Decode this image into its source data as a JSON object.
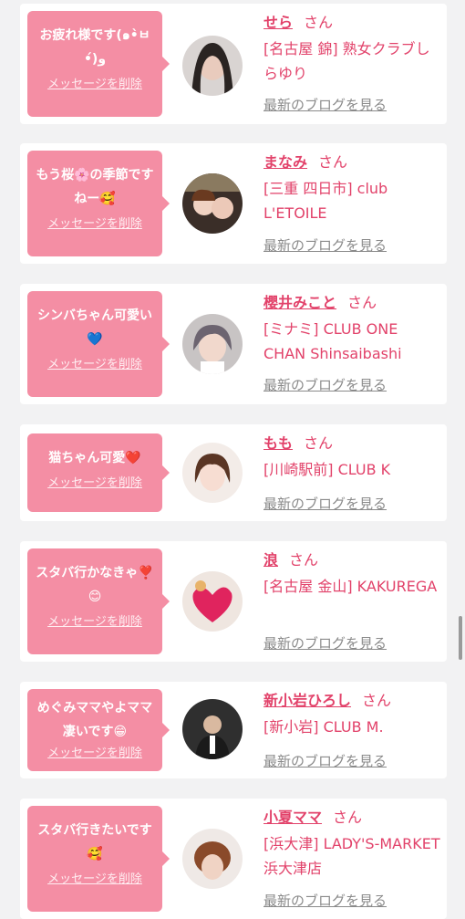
{
  "entries": [
    {
      "message": "お疲れ様です(๑•̀ㅂ•́)و",
      "delete_label": "メッセージを削除",
      "name": "せら",
      "honorific": "さん",
      "shop": "[名古屋 錦] 熟女クラブしらゆり",
      "blog_label": "最新のブログを見る"
    },
    {
      "message": "もう桜🌸の季節ですねー🥰",
      "delete_label": "メッセージを削除",
      "name": "まなみ",
      "honorific": "さん",
      "shop": "[三重 四日市] club L'ETOILE",
      "blog_label": "最新のブログを見る"
    },
    {
      "message": "シンバちゃん可愛い💙",
      "delete_label": "メッセージを削除",
      "name": "櫻井みこと",
      "honorific": "さん",
      "shop": "[ミナミ] CLUB ONE CHAN Shinsaibashi",
      "blog_label": "最新のブログを見る"
    },
    {
      "message": "猫ちゃん可愛❤️",
      "delete_label": "メッセージを削除",
      "name": "もも",
      "honorific": "さん",
      "shop": "[川崎駅前] CLUB K",
      "blog_label": "最新のブログを見る"
    },
    {
      "message": "スタバ行かなきゃ❣️😊",
      "delete_label": "メッセージを削除",
      "name": "浪",
      "honorific": "さん",
      "shop": "[名古屋 金山] KAKUREGA",
      "blog_label": "最新のブログを見る"
    },
    {
      "message": "めぐみママやよママ凄いです😁",
      "delete_label": "メッセージを削除",
      "name": "新小岩ひろし",
      "honorific": "さん",
      "shop": "[新小岩] CLUB M.",
      "blog_label": "最新のブログを見る"
    },
    {
      "message": "スタバ行きたいです🥰",
      "delete_label": "メッセージを削除",
      "name": "小夏ママ",
      "honorific": "さん",
      "shop": "[浜大津] LADY'S-MARKET 浜大津店",
      "blog_label": "最新のブログを見る"
    }
  ],
  "colors": {
    "bubble": "#f48ea4",
    "name_text": "#e2426a",
    "link_gray": "#8a8a8a",
    "background": "#f2f2f3"
  }
}
